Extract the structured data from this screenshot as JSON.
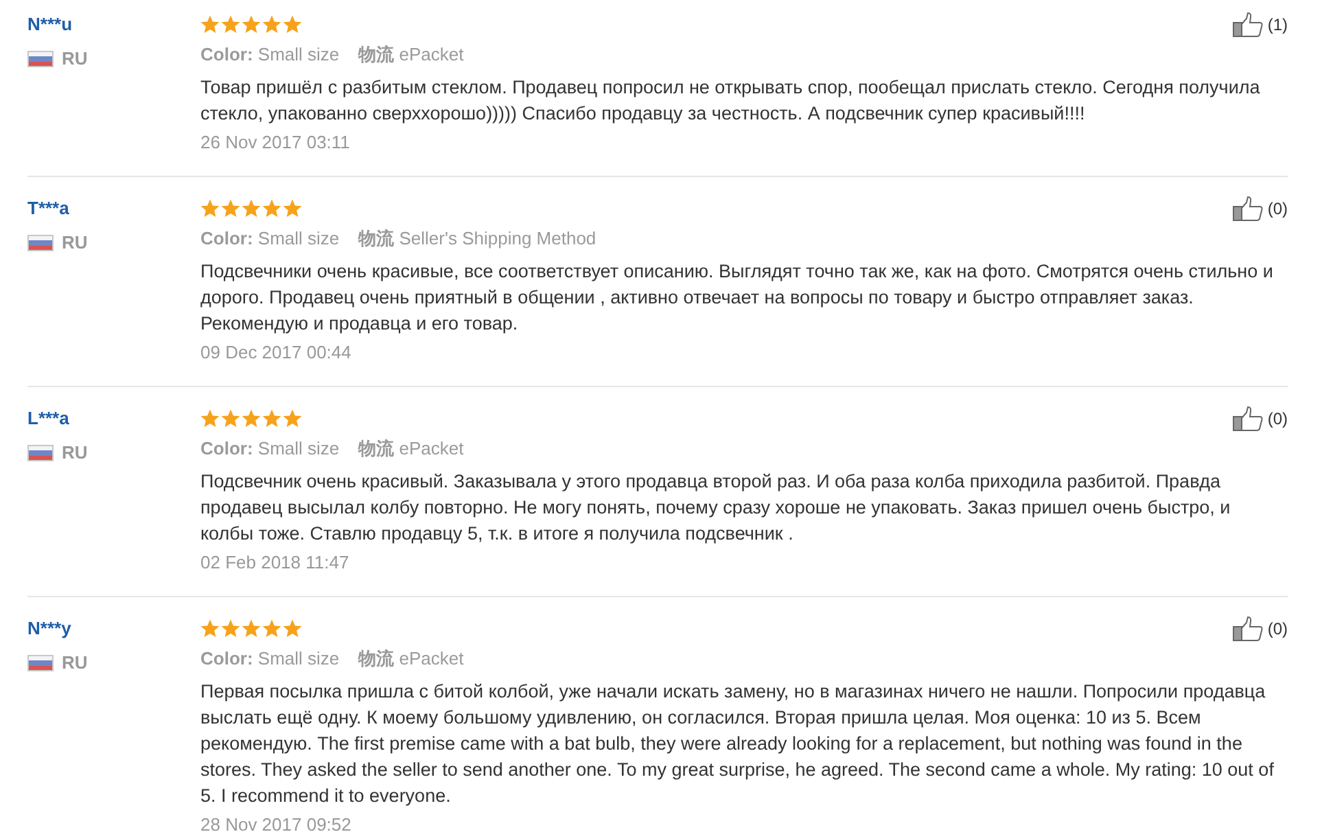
{
  "reviews": [
    {
      "reviewer": "N***u",
      "country": "RU",
      "stars": 5,
      "attributes": [
        "**Color:** Small size",
        "**物流** ePacket"
      ],
      "helpful_count": "(1)",
      "text": "Товар пришёл с разбитым стеклом. Продавец попросил не открывать спор, пообещал прислать стекло. Сегодня получила стекло, упакованно сверххорошо))))) Спасибо продавцу за честность. А подсвечник супер красивый!!!!",
      "date": "26 Nov 2017 03:11"
    },
    {
      "reviewer": "T***a",
      "country": "RU",
      "stars": 5,
      "attributes": [
        "**Color:** Small size",
        "**物流** Seller's Shipping Method"
      ],
      "helpful_count": "(0)",
      "text": "Подсвечники очень красивые, все соответствует описанию. Выглядят точно так же, как на фото. Смотрятся очень стильно и дорого. Продавец очень приятный в общении , активно отвечает на вопросы по товару и быстро отправляет заказ. Рекомендую и продавца и его товар.",
      "date": "09 Dec 2017 00:44"
    },
    {
      "reviewer": "L***a",
      "country": "RU",
      "stars": 5,
      "attributes": [
        "**Color:** Small size",
        "**物流** ePacket"
      ],
      "helpful_count": "(0)",
      "text": "Подсвечник очень красивый. Заказывала у этого продавца второй раз. И оба раза колба приходила разбитой. Правда продавец высылал колбу повторно. Не могу понять, почему сразу хороше не упаковать. Заказ пришел очень быстро, и колбы тоже. Ставлю продавцу 5, т.к. в итоге я получила подсвечник .",
      "date": "02 Feb 2018 11:47"
    },
    {
      "reviewer": "N***y",
      "country": "RU",
      "stars": 5,
      "attributes": [
        "**Color:** Small size",
        "**物流** ePacket"
      ],
      "helpful_count": "(0)",
      "text": "Первая посылка пришла с битой колбой, уже начали искать замену, но в магазинах ничего не нашли. Попросили продавца выслать ещё одну. К моему большому удивлению, он согласился. Вторая пришла целая. Моя оценка: 10 из 5. Всем рекомендую. The first premise came with a bat bulb, they were already looking for a replacement, but nothing was found in the stores. They asked the seller to send another one. To my great surprise, he agreed. The second came a whole. My rating: 10 out of 5. I recommend it to everyone.",
      "date": "28 Nov 2017 09:52"
    }
  ]
}
